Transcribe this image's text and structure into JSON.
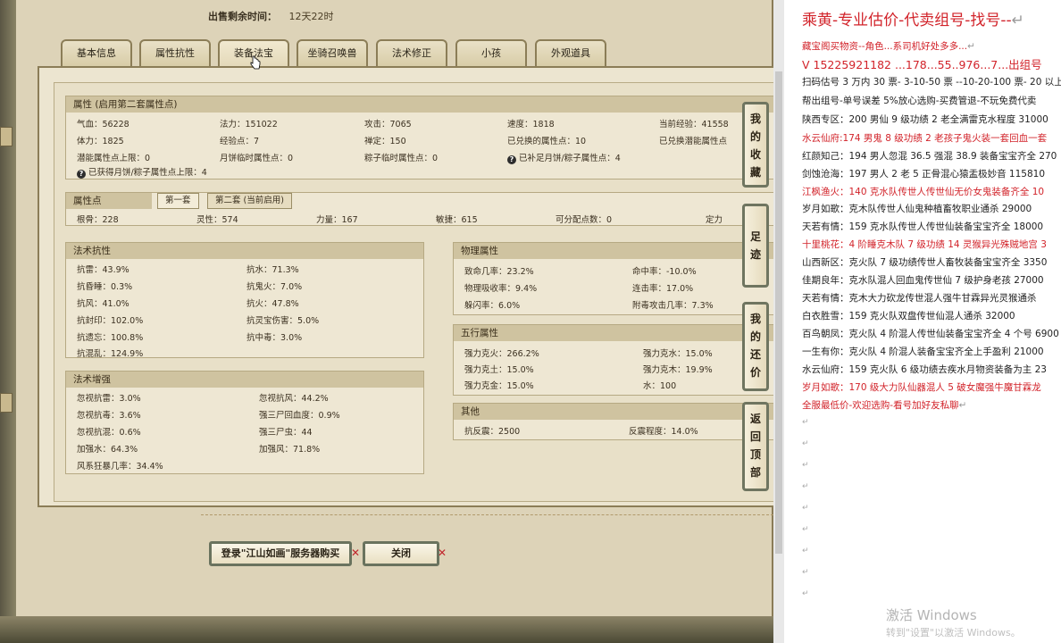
{
  "game": {
    "sale_time_label": "出售剩余时间：",
    "sale_time_value": "12天22时",
    "tabs": [
      {
        "label": "基本信息"
      },
      {
        "label": "属性抗性"
      },
      {
        "label": "装备法宝"
      },
      {
        "label": "坐骑召唤兽"
      },
      {
        "label": "法术修正"
      },
      {
        "label": "小孩"
      },
      {
        "label": "外观道具"
      }
    ],
    "attr_section": {
      "title": "属性 (启用第二套属性点)",
      "row1": [
        "气血：56228",
        "法力：151022",
        "攻击：7065",
        "速度：1818",
        "当前经验：41558"
      ],
      "row2": [
        "体力：1825",
        "经验点：7",
        "禅定：150",
        "已兑换的属性点：10",
        "已兑换潜能属性点"
      ],
      "row3": [
        "潜能属性点上限：0",
        "月饼临时属性点：0",
        "粽子临时属性点：0",
        "已补足月饼/粽子属性点：4"
      ],
      "row4": "已获得月饼/粽子属性点上限：4"
    },
    "points_section": {
      "title": "属性点",
      "subtab1": "第一套",
      "subtab2": "第二套 (当前启用)",
      "row": [
        "根骨：228",
        "灵性：574",
        "力量：167",
        "敏捷：615",
        "可分配点数：0",
        "定力"
      ]
    },
    "resist_section": {
      "title": "法术抗性",
      "left": [
        "抗雷：43.9%",
        "抗昏睡：0.3%",
        "抗风：41.0%",
        "抗封印：102.0%",
        "抗遗忘：100.8%",
        "抗混乱：124.9%"
      ],
      "right": [
        "抗水：71.3%",
        "抗鬼火：7.0%",
        "抗火：47.8%",
        "抗灵宝伤害：5.0%",
        "抗中毒：3.0%"
      ]
    },
    "enhance_section": {
      "title": "法术增强",
      "left": [
        "忽视抗雷：3.0%",
        "忽视抗毒：3.6%",
        "忽视抗混：0.6%",
        "加强水：64.3%",
        "风系狂暴几率：34.4%"
      ],
      "right": [
        "忽视抗风：44.2%",
        "强三尸回血度：0.9%",
        "强三尸虫：44",
        "加强风：71.8%"
      ]
    },
    "physical_section": {
      "title": "物理属性",
      "left": [
        "致命几率：23.2%",
        "物理吸收率：9.4%",
        "躲闪率：6.0%"
      ],
      "right": [
        "命中率：-10.0%",
        "连击率：17.0%",
        "附毒攻击几率：7.3%"
      ]
    },
    "five_section": {
      "title": "五行属性",
      "left": [
        "强力克火：266.2%",
        "强力克土：15.0%",
        "强力克金：15.0%"
      ],
      "right": [
        "强力克水：15.0%",
        "强力克木：19.9%",
        "水：100"
      ]
    },
    "other_section": {
      "title": "其他",
      "left": "抗反震：2500",
      "right": "反震程度：14.0%"
    },
    "side_buttons": [
      {
        "label": "我的收藏",
        "chars": [
          "我",
          "的",
          "收",
          "藏"
        ]
      },
      {
        "label": "足迹",
        "chars": [
          "足",
          "迹"
        ]
      },
      {
        "label": "我的还价",
        "chars": [
          "我",
          "的",
          "还",
          "价"
        ]
      },
      {
        "label": "返回顶部",
        "chars": [
          "返",
          "回",
          "顶",
          "部"
        ]
      }
    ],
    "buy_button": "登录\"江山如画\"服务器购买",
    "close_button": "关闭"
  },
  "doc": {
    "title": "乘黄-专业估价-代卖组号-找号--",
    "lines": [
      {
        "text": "藏宝阁买物资--角色...系司机好处多多...",
        "color": "red"
      },
      {
        "text": "V 15225921182  ...178...55..976...7...出组号",
        "color": "red",
        "big": true
      },
      {
        "text": "扫码估号 3 万内 30 票- 3-10-50 票  --10-20-100 票- 20 以上",
        "color": "black"
      },
      {
        "text": "帮出组号-单号误差 5%放心选购-买费管退-不玩免费代卖",
        "color": "black"
      },
      {
        "text": "陕西专区：200 男仙 9 级功绩 2 老全满雷克水程度 31000",
        "color": "black"
      },
      {
        "text": "水云仙府:174 男鬼 8 级功绩 2 老孩子鬼火装一套回血一套",
        "color": "red"
      },
      {
        "text": "红颜知己：194 男人忽混 36.5 强混 38.9 装备宝宝齐全 270",
        "color": "black"
      },
      {
        "text": "剑蚀沧海：197 男人 2 老 5 正骨混心猿盂极妙音 115810",
        "color": "black"
      },
      {
        "text": "江枫渔火：140 克水队传世人传世仙无价女鬼装备齐全 10",
        "color": "red"
      },
      {
        "text": "岁月如歌：克木队传世人仙鬼种植畜牧职业通杀 29000",
        "color": "black"
      },
      {
        "text": "天若有情：159 克水队传世人传世仙装备宝宝齐全 18000",
        "color": "black"
      },
      {
        "text": "十里桃花：4 阶睡克木队 7 级功绩 14 灵猴异光殊贼地宫 3",
        "color": "red"
      },
      {
        "text": "山西新区：克火队 7 级功绩传世人畜牧装备宝宝齐全 3350",
        "color": "black"
      },
      {
        "text": "佳期良年：克水队混人回血鬼传世仙 7 级护身老孩 27000",
        "color": "black"
      },
      {
        "text": "天若有情：克木大力砍龙传世混人强牛甘霖异光灵猴通杀",
        "color": "black"
      },
      {
        "text": "白衣胜雪：159 克火队双盘传世仙混人通杀 32000",
        "color": "black"
      },
      {
        "text": "百鸟朝凤：克火队 4 阶混人传世仙装备宝宝齐全 4 个号 6900",
        "color": "black"
      },
      {
        "text": "一生有你：克火队 4 阶混人装备宝宝齐全上手盈利 21000",
        "color": "black"
      },
      {
        "text": "水云仙府：159 克火队 6 级功绩去疾水月物资装备为主 23",
        "color": "black"
      },
      {
        "text": "岁月如歌：170 级大力队仙器混人 5 破女魔强牛魔甘霖龙",
        "color": "red"
      },
      {
        "text": "全服最低价-欢迎选购-看号加好友私聊",
        "color": "red"
      }
    ],
    "para_mark": "↵",
    "watermark_line1": "激活 Windows",
    "watermark_line2": "转到\"设置\"以激活 Windows。"
  }
}
